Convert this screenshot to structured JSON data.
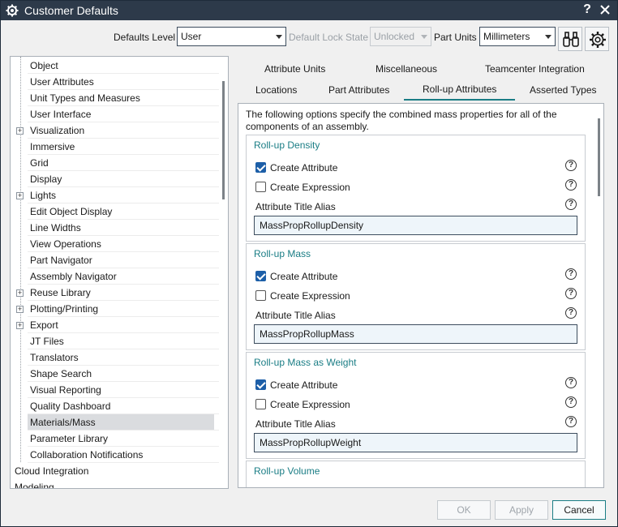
{
  "window": {
    "title": "Customer Defaults",
    "help_label": "?"
  },
  "toolbar": {
    "defaults_level_label": "Defaults Level",
    "defaults_level_value": "User",
    "lock_state_label": "Default Lock State",
    "lock_state_value": "Unlocked",
    "part_units_label": "Part Units",
    "part_units_value": "Millimeters"
  },
  "tree": {
    "items": [
      {
        "label": "Object",
        "expandable": false
      },
      {
        "label": "User Attributes",
        "expandable": false
      },
      {
        "label": "Unit Types and Measures",
        "expandable": false
      },
      {
        "label": "User Interface",
        "expandable": false
      },
      {
        "label": "Visualization",
        "expandable": true
      },
      {
        "label": "Immersive",
        "expandable": false
      },
      {
        "label": "Grid",
        "expandable": false
      },
      {
        "label": "Display",
        "expandable": false
      },
      {
        "label": "Lights",
        "expandable": true
      },
      {
        "label": "Edit Object Display",
        "expandable": false
      },
      {
        "label": "Line Widths",
        "expandable": false
      },
      {
        "label": "View Operations",
        "expandable": false
      },
      {
        "label": "Part Navigator",
        "expandable": false
      },
      {
        "label": "Assembly Navigator",
        "expandable": false
      },
      {
        "label": "Reuse Library",
        "expandable": true
      },
      {
        "label": "Plotting/Printing",
        "expandable": true
      },
      {
        "label": "Export",
        "expandable": true
      },
      {
        "label": "JT Files",
        "expandable": false
      },
      {
        "label": "Translators",
        "expandable": false
      },
      {
        "label": "Shape Search",
        "expandable": false
      },
      {
        "label": "Visual Reporting",
        "expandable": false
      },
      {
        "label": "Quality Dashboard",
        "expandable": false
      },
      {
        "label": "Materials/Mass",
        "expandable": false,
        "selected": true
      },
      {
        "label": "Parameter Library",
        "expandable": false
      },
      {
        "label": "Collaboration Notifications",
        "expandable": false
      }
    ],
    "root_items": [
      "Cloud Integration",
      "Modeling"
    ]
  },
  "tabs": {
    "row1": [
      "Attribute Units",
      "Miscellaneous",
      "Teamcenter Integration"
    ],
    "row2": [
      "Locations",
      "Part Attributes",
      "Roll-up Attributes",
      "Asserted Types"
    ],
    "active": "Roll-up Attributes"
  },
  "content": {
    "description": "The following options specify the combined mass properties for all of the components of an assembly.",
    "groups": [
      {
        "title": "Roll-up Density",
        "create_attribute": "Create Attribute",
        "create_attribute_checked": true,
        "create_expression": "Create Expression",
        "create_expression_checked": false,
        "alias_label": "Attribute Title Alias",
        "alias_value": "MassPropRollupDensity"
      },
      {
        "title": "Roll-up Mass",
        "create_attribute": "Create Attribute",
        "create_attribute_checked": true,
        "create_expression": "Create Expression",
        "create_expression_checked": false,
        "alias_label": "Attribute Title Alias",
        "alias_value": "MassPropRollupMass"
      },
      {
        "title": "Roll-up Mass as Weight",
        "create_attribute": "Create Attribute",
        "create_attribute_checked": true,
        "create_expression": "Create Expression",
        "create_expression_checked": false,
        "alias_label": "Attribute Title Alias",
        "alias_value": "MassPropRollupWeight"
      },
      {
        "title": "Roll-up Volume"
      }
    ],
    "help_glyph": "?"
  },
  "buttons": {
    "ok": "OK",
    "apply": "Apply",
    "cancel": "Cancel"
  },
  "colors": {
    "titlebar": "#2d3a4a",
    "accent": "#1a7d85",
    "checkbox": "#1d5fa8"
  }
}
